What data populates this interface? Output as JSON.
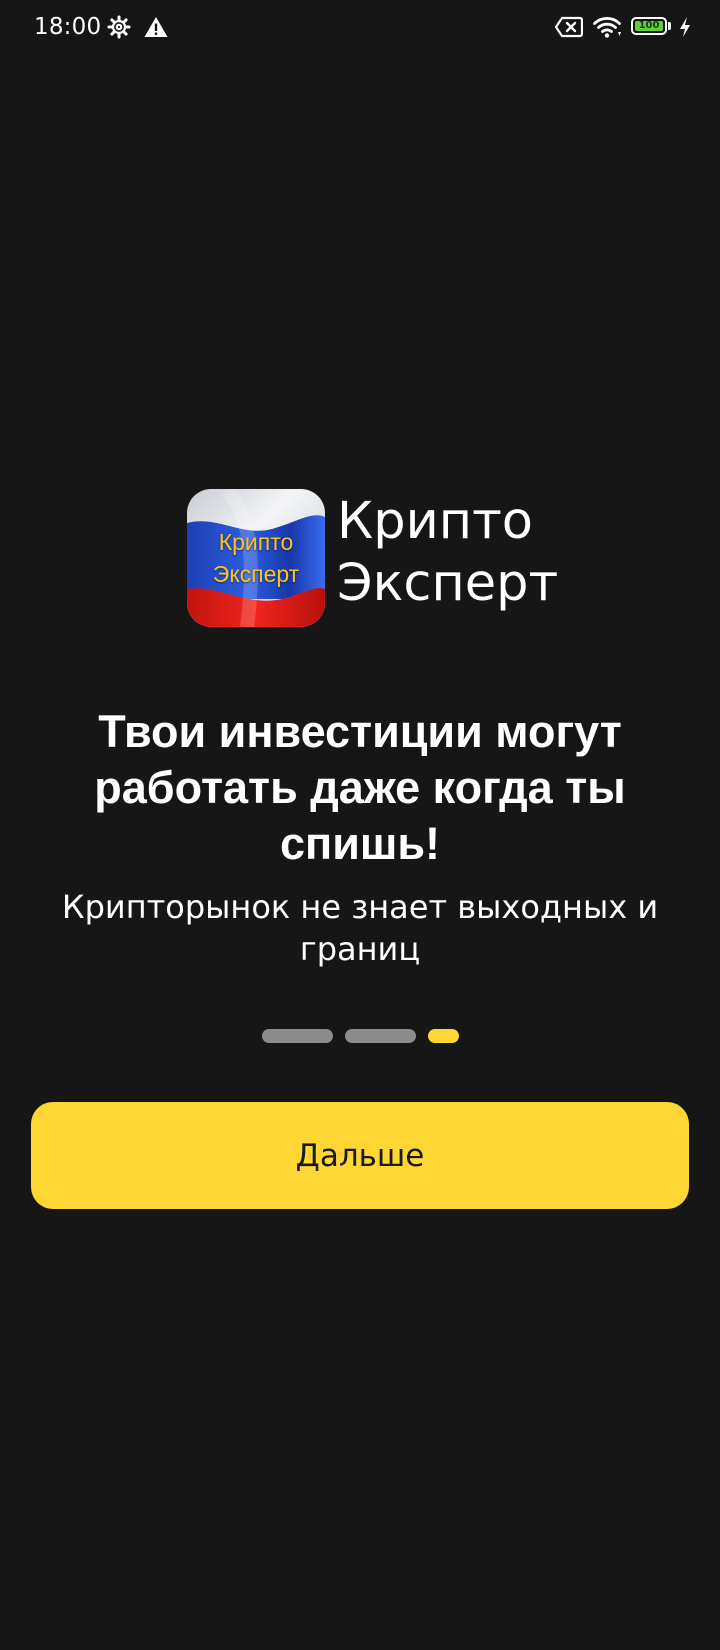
{
  "status_bar": {
    "time": "18:00",
    "battery_level": "100",
    "left_icons": [
      "settings-gear-icon",
      "warning-icon"
    ],
    "right_icons": [
      "no-sim-icon",
      "wifi-icon",
      "battery-icon",
      "charging-bolt-icon"
    ]
  },
  "logo": {
    "icon_line1": "Крипто",
    "icon_line2": "Эксперт",
    "name_line1": "Крипто",
    "name_line2": "Эксперт",
    "icon_text_color": "#ffc21a"
  },
  "onboarding": {
    "headline": "Твои инвестиции могут работать даже когда ты спишь!",
    "subtitle": "Крипторынок не знает выходных и границ",
    "page_count": 3,
    "active_page": 3
  },
  "next_button": {
    "label": "Дальше"
  },
  "colors": {
    "background": "#161616",
    "accent": "#ffd633",
    "inactive_dot": "#8c8c8c",
    "text": "#ffffff"
  }
}
